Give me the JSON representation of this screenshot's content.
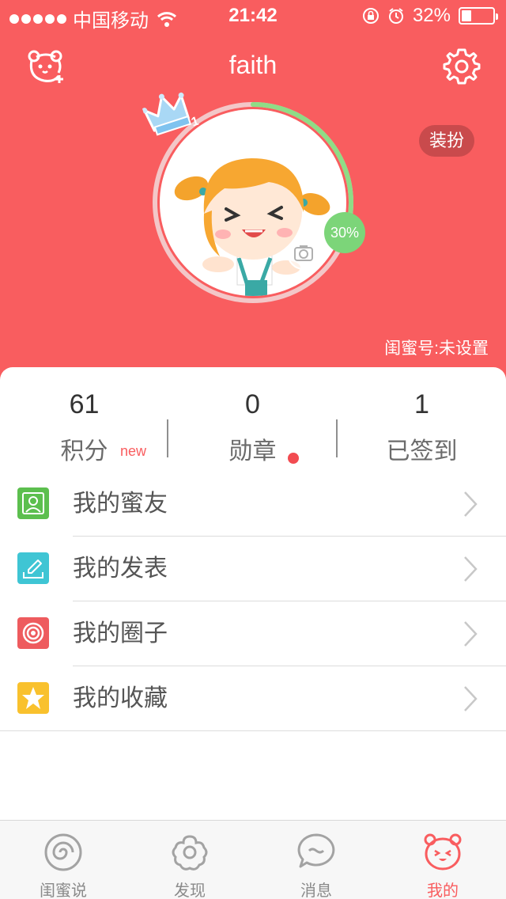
{
  "status_bar": {
    "carrier": "中国移动",
    "time": "21:42",
    "battery": "32%",
    "battery_level": 0.32
  },
  "header": {
    "title": "faith",
    "dress_button": "装扮",
    "progress": "30%",
    "progress_value": 0.3,
    "user_id": "闺蜜号:未设置",
    "crown_level": "1"
  },
  "stats": [
    {
      "value": "61",
      "label": "积分",
      "badge": "new"
    },
    {
      "value": "0",
      "label": "勋章"
    },
    {
      "value": "1",
      "label": "已签到"
    }
  ],
  "menu": [
    {
      "label": "我的蜜友",
      "icon": "friends-icon",
      "color": "#5cbf4e"
    },
    {
      "label": "我的发表",
      "icon": "post-icon",
      "color": "#3fc5d4"
    },
    {
      "label": "我的圈子",
      "icon": "circle-icon",
      "color": "#ee5b5e"
    },
    {
      "label": "我的收藏",
      "icon": "star-icon",
      "color": "#f9c12d"
    }
  ],
  "tabs": [
    {
      "label": "闺蜜说",
      "icon": "spiral-icon"
    },
    {
      "label": "发现",
      "icon": "flower-icon"
    },
    {
      "label": "消息",
      "icon": "chat-icon"
    },
    {
      "label": "我的",
      "icon": "bear-face-icon",
      "active": true
    }
  ],
  "colors": {
    "brand": "#f95d5f",
    "progress": "#7cd579"
  }
}
